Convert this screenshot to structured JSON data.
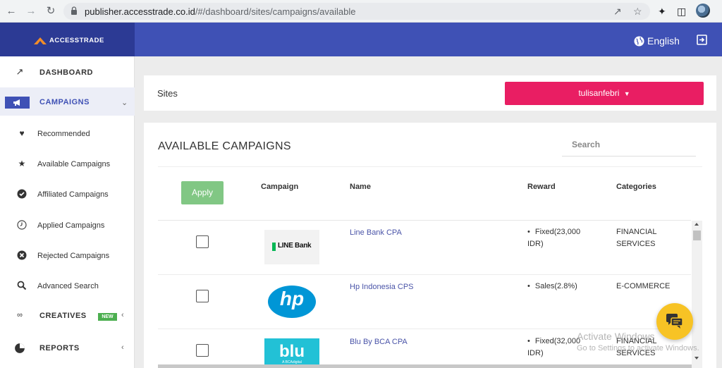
{
  "browser": {
    "url_host": "publisher.accesstrade.co.id",
    "url_path": "/#/dashboard/sites/campaigns/available",
    "back_icon": "back-arrow",
    "forward_icon": "forward-arrow",
    "reload_icon": "reload"
  },
  "header": {
    "brand": "ACCESSTRADE",
    "language": "English"
  },
  "sidebar": {
    "dashboard": "DASHBOARD",
    "campaigns": "CAMPAIGNS",
    "sub_items": [
      {
        "label": "Recommended",
        "icon": "heart-icon"
      },
      {
        "label": "Available Campaigns",
        "icon": "star-icon"
      },
      {
        "label": "Affiliated Campaigns",
        "icon": "check-circle-icon"
      },
      {
        "label": "Applied Campaigns",
        "icon": "clock-icon"
      },
      {
        "label": "Rejected Campaigns",
        "icon": "x-circle-icon"
      },
      {
        "label": "Advanced Search",
        "icon": "search-icon"
      }
    ],
    "creatives": "CREATIVES",
    "creatives_badge": "NEW",
    "reports": "REPORTS"
  },
  "sites": {
    "label": "Sites",
    "selected_site": "tulisanfebri"
  },
  "campaigns": {
    "title": "AVAILABLE CAMPAIGNS",
    "search_placeholder": "Search",
    "apply_label": "Apply",
    "columns": {
      "campaign": "Campaign",
      "name": "Name",
      "reward": "Reward",
      "categories": "Categories"
    },
    "rows": [
      {
        "logo_text": "LINE Bank",
        "name": "Line Bank CPA",
        "reward_1": "Fixed(23,000",
        "reward_2": "IDR)",
        "category_1": "FINANCIAL",
        "category_2": "SERVICES",
        "checked": false
      },
      {
        "logo_text": "hp",
        "name": "Hp Indonesia CPS",
        "reward_1": "Sales(2.8%)",
        "reward_2": "",
        "category_1": "E-COMMERCE",
        "category_2": "",
        "checked": false
      },
      {
        "logo_text": "blu",
        "logo_sub": "A BCAdigital",
        "name": "Blu By BCA CPA",
        "reward_1": "Fixed(32,000",
        "reward_2": "IDR)",
        "category_1": "FINANCIAL",
        "category_2": "SERVICES",
        "checked": false
      }
    ]
  },
  "watermark": {
    "line1": "Activate Windows",
    "line2": "Go to Settings to activate Windows."
  },
  "colors": {
    "header": "#3f51b5",
    "brand_bg": "#2c3a94",
    "site_button": "#e91e63",
    "apply_button": "#81c784",
    "new_badge": "#4caf50",
    "chat_button": "#f7c325",
    "link": "#4a54a8"
  }
}
